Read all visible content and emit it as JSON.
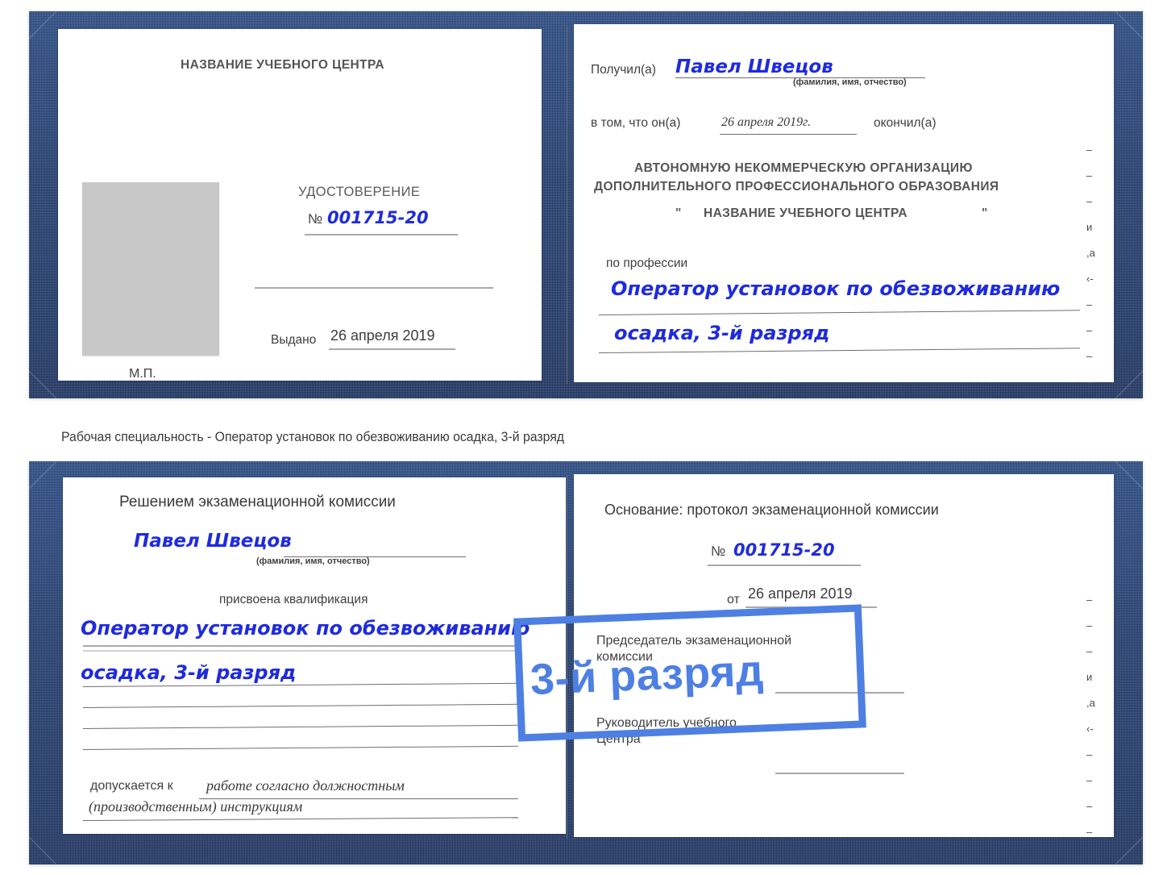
{
  "caption": "Рабочая специальность - Оператор установок по обезвоживанию осадка, 3-й разряд",
  "colors": {
    "cover_blue": "#213f76",
    "ink_blue": "#1f2bdc",
    "watermark_blue": "#4e7fe3",
    "photo_gray": "#c8c8c8",
    "paper": "#ffffff"
  },
  "watermark": {
    "text": "3-й разряд"
  },
  "certificate_top": {
    "left_page": {
      "header": "НАЗВАНИЕ УЧЕБНОГО ЦЕНТРА",
      "doc_title": "УДОСТОВЕРЕНИЕ",
      "number_symbol": "№",
      "number_value": "001715-20",
      "issued_label": "Выдано",
      "issued_value": "26 апреля 2019",
      "stamp_label": "М.П.",
      "photo_placeholder": "photo-placeholder"
    },
    "right_page": {
      "received_label": "Получил(а)",
      "received_value": "Павел Швецов",
      "name_hint": "(фамилия, имя, отчество)",
      "in_that_label": "в том, что он(а)",
      "in_that_value": "26 апреля 2019г.",
      "finished_label": "окончил(а)",
      "org_line1": "АВТОНОМНУЮ НЕКОММЕРЧЕСКУЮ ОРГАНИЗАЦИЮ",
      "org_line2": "ДОПОЛНИТЕЛЬНОГО ПРОФЕССИОНАЛЬНОГО ОБРАЗОВАНИЯ",
      "org_quote_open": "\"",
      "org_line3": "НАЗВАНИЕ УЧЕБНОГО ЦЕНТРА",
      "org_quote_close": "\"",
      "profession_label": "по профессии",
      "profession_line1": "Оператор установок по обезвоживанию",
      "profession_line2": "осадка, 3-й разряд",
      "edge_fragments": [
        "–",
        "–",
        "–",
        "и",
        ",а",
        "‹-",
        "–",
        "–",
        "–",
        "–"
      ]
    }
  },
  "certificate_bottom": {
    "left_page": {
      "header": "Решением экзаменационной комиссии",
      "name_value": "Павел Швецов",
      "name_hint": "(фамилия, имя, отчество)",
      "qualification_label": "присвоена квалификация",
      "qualification_line1": "Оператор установок по обезвоживанию",
      "qualification_line2": "осадка, 3-й разряд",
      "allowed_label": "допускается к",
      "allowed_value_line1": "работе согласно должностным",
      "allowed_value_line2": "(производственным) инструкциям"
    },
    "right_page": {
      "basis_label": "Основание: протокол  экзаменационной  комиссии",
      "number_symbol": "№",
      "number_value": "001715-20",
      "from_label": "от",
      "from_value": "26 апреля 2019",
      "chair_line1": "Председатель экзаменационной",
      "chair_line2": "комиссии",
      "head_line1": "Руководитель учебного",
      "head_line2": "Центра",
      "edge_fragments": [
        "–",
        "–",
        "–",
        "и",
        ",а",
        "‹-",
        "–",
        "–",
        "–",
        "–"
      ]
    }
  }
}
